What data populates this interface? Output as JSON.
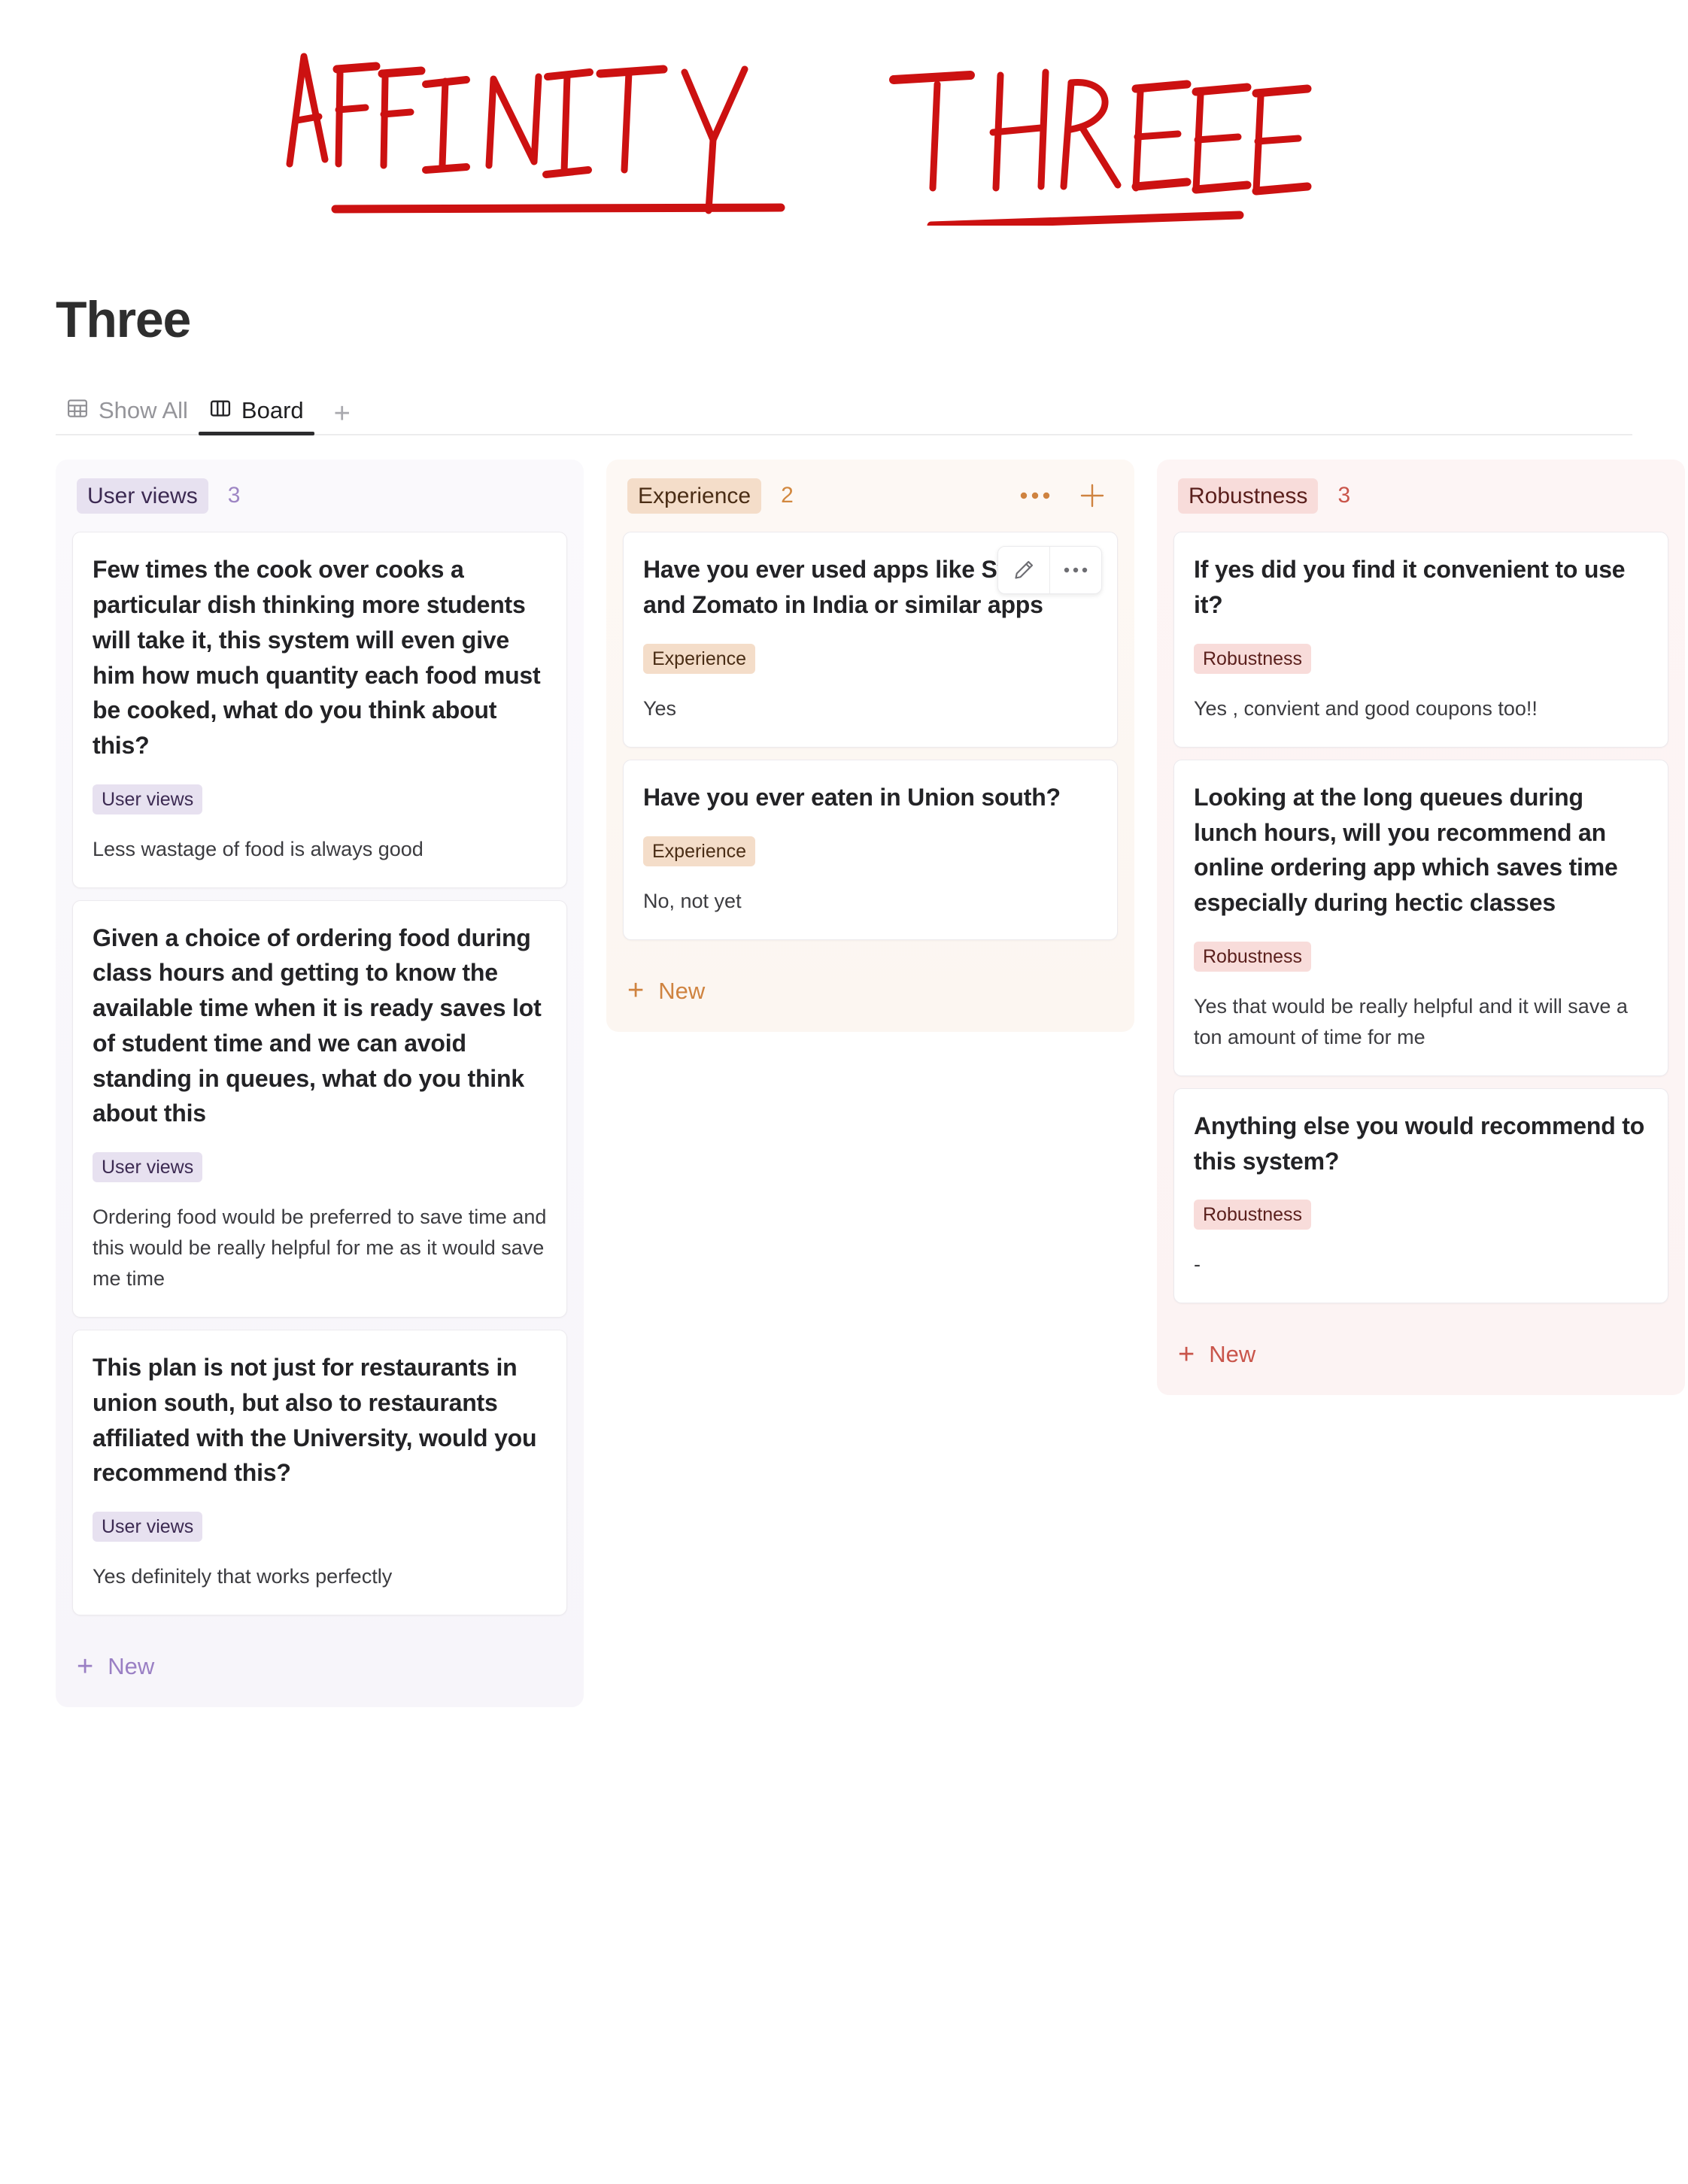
{
  "annotation": {
    "text_left": "AFFINITY",
    "text_right": "THREE",
    "color": "#cc1111"
  },
  "header": {
    "title": "Three"
  },
  "tabs": [
    {
      "label": "Show All",
      "icon": "table-grid-icon",
      "active": false
    },
    {
      "label": "Board",
      "icon": "board-columns-icon",
      "active": true
    }
  ],
  "tabs_add_label": "+",
  "columns": [
    {
      "id": "user-views",
      "name": "User views",
      "count": "3",
      "badge_bg": "#e7e1f0",
      "badge_fg": "#3c2a52",
      "count_color": "#9e86c4",
      "has_head_actions": false,
      "new_label": "New",
      "cards": [
        {
          "title": "Few times the cook over cooks a particular dish thinking more students will take it, this system will even give him how much quantity each food must be cooked, what do you think about this?",
          "tag": "User views",
          "answer": "Less wastage of food is always good",
          "toolbar": false
        },
        {
          "title": "Given a choice of ordering food during class hours and getting to know the available time when it is ready saves lot of student time and we can avoid standing in queues, what do you think about this",
          "tag": "User views",
          "answer": "Ordering food would be preferred to save time and this would be really helpful for me as it would save me time",
          "toolbar": false
        },
        {
          "title": "This plan is not just for restaurants in union south, but also to restaurants affiliated with the University, would you recommend this?",
          "tag": "User views",
          "answer": "Yes definitely that works perfectly",
          "toolbar": false
        }
      ]
    },
    {
      "id": "experience",
      "name": "Experience",
      "count": "2",
      "badge_bg": "#f4ddc9",
      "badge_fg": "#4a2d15",
      "count_color": "#d2883f",
      "has_head_actions": true,
      "new_label": "New",
      "cards": [
        {
          "title": "Have you ever used apps like Swiggy and Zomato in India or similar apps",
          "tag": "Experience",
          "answer": "Yes",
          "toolbar": true
        },
        {
          "title": "Have you ever eaten in Union south?",
          "tag": "Experience",
          "answer": "No, not yet",
          "toolbar": false
        }
      ]
    },
    {
      "id": "robustness",
      "name": "Robustness",
      "count": "3",
      "badge_bg": "#f8dcda",
      "badge_fg": "#5a1f1c",
      "count_color": "#c9554b",
      "has_head_actions": false,
      "new_label": "New",
      "cards": [
        {
          "title": "If yes did you find it convenient to use it?",
          "tag": "Robustness",
          "answer": "Yes , convient and good coupons too!!",
          "toolbar": false
        },
        {
          "title": "Looking at the long queues during lunch hours, will you recommend an online ordering app which saves time especially during hectic classes",
          "tag": "Robustness",
          "answer": "Yes that would be really helpful and it will save a ton amount of time for me",
          "toolbar": false
        },
        {
          "title": "Anything else you would recommend to this system?",
          "tag": "Robustness",
          "answer": "-",
          "toolbar": false
        }
      ]
    }
  ],
  "card_toolbar": {
    "edit_icon": "pencil-icon",
    "more_icon": "ellipsis-icon"
  }
}
